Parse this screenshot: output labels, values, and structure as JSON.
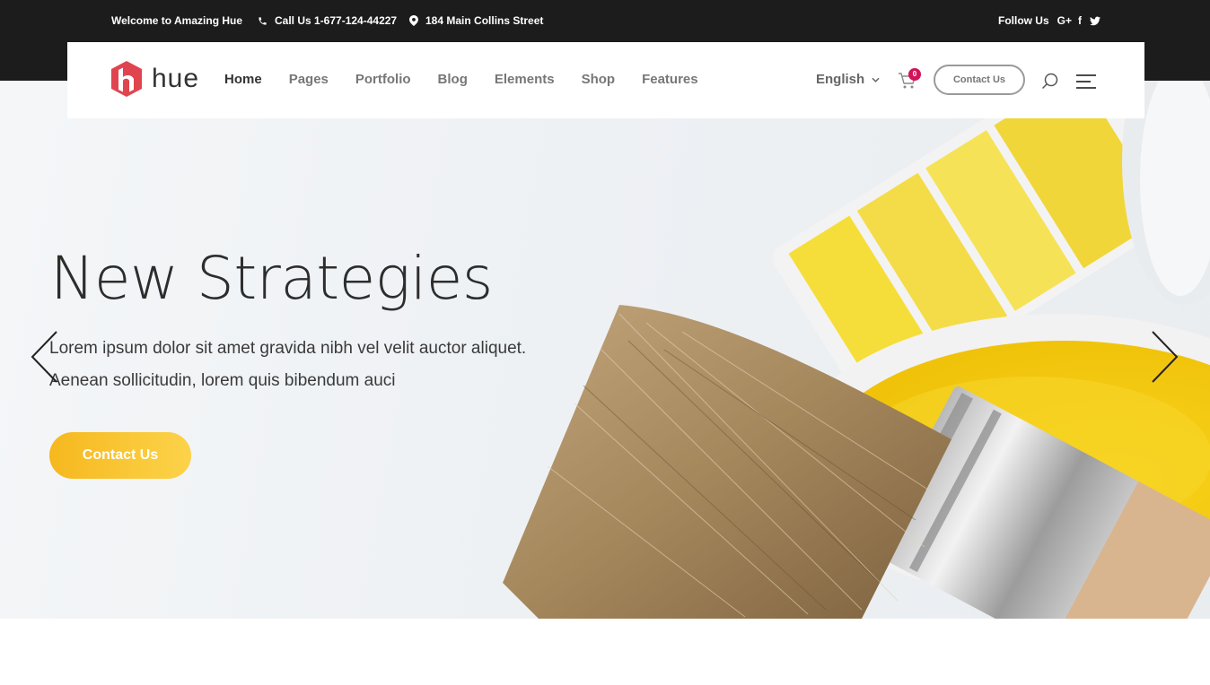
{
  "topbar": {
    "welcome": "Welcome to Amazing Hue",
    "phone": "Call Us 1-677-124-44227",
    "address": "184 Main Collins Street",
    "follow": "Follow Us",
    "social": [
      "G+",
      "f",
      "twitter"
    ]
  },
  "header": {
    "logo_text": "hue",
    "nav": [
      "Home",
      "Pages",
      "Portfolio",
      "Blog",
      "Elements",
      "Shop",
      "Features"
    ],
    "language": "English",
    "cart_count": "0",
    "contact_button": "Contact Us"
  },
  "hero": {
    "title": "New Strategies",
    "line1": "Lorem ipsum dolor sit amet gravida nibh vel velit auctor aliquet.",
    "line2": "Aenean sollicitudin, lorem quis bibendum auci",
    "cta": "Contact Us"
  },
  "colors": {
    "accent": "#d1145a",
    "cta": "#f8c227",
    "topbar": "#1c1c1c"
  }
}
